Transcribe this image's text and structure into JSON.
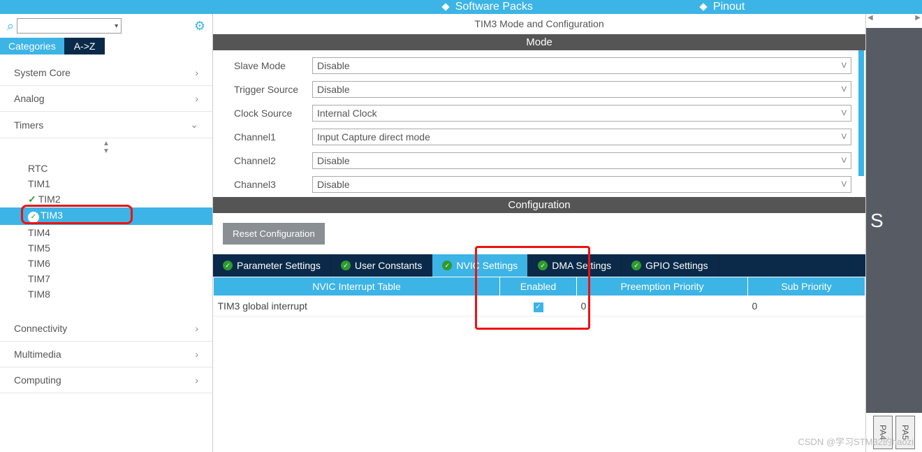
{
  "topbar": {
    "item1": "Software Packs",
    "item2": "Pinout"
  },
  "sidebar": {
    "tabs": {
      "categories": "Categories",
      "az": "A->Z"
    },
    "cats": {
      "system": "System Core",
      "analog": "Analog",
      "timers": "Timers",
      "connectivity": "Connectivity",
      "multimedia": "Multimedia",
      "computing": "Computing"
    },
    "timers": [
      "RTC",
      "TIM1",
      "TIM2",
      "TIM3",
      "TIM4",
      "TIM5",
      "TIM6",
      "TIM7",
      "TIM8"
    ]
  },
  "main": {
    "title": "TIM3 Mode and Configuration",
    "mode_header": "Mode",
    "config_header": "Configuration",
    "reset": "Reset Configuration",
    "mode": {
      "rows": [
        {
          "label": "Slave Mode",
          "value": "Disable"
        },
        {
          "label": "Trigger Source",
          "value": "Disable"
        },
        {
          "label": "Clock Source",
          "value": "Internal Clock"
        },
        {
          "label": "Channel1",
          "value": "Input Capture direct mode"
        },
        {
          "label": "Channel2",
          "value": "Disable"
        },
        {
          "label": "Channel3",
          "value": "Disable"
        }
      ]
    },
    "subtabs": [
      "Parameter Settings",
      "User Constants",
      "NVIC Settings",
      "DMA Settings",
      "GPIO Settings"
    ],
    "table": {
      "headers": [
        "NVIC Interrupt Table",
        "Enabled",
        "Preemption Priority",
        "Sub Priority"
      ],
      "row": {
        "name": "TIM3 global interrupt",
        "enabled": true,
        "pre": "0",
        "sub": "0"
      }
    }
  },
  "right": {
    "chip": "S",
    "pins": [
      "PA4",
      "PA5"
    ]
  },
  "watermark": "CSDN @学习STM32的haozi"
}
